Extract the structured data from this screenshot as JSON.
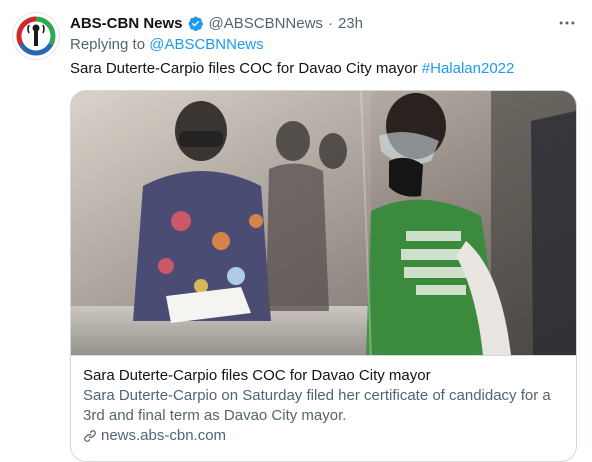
{
  "account": {
    "name": "ABS-CBN News",
    "handle": "@ABSCBNNews",
    "separator": "·",
    "time": "23h",
    "verified": true,
    "avatar_icon": "abs-cbn-logo"
  },
  "reply": {
    "prefix": "Replying to",
    "to": "@ABSCBNNews"
  },
  "tweet": {
    "text": "Sara Duterte-Carpio files COC for Davao City mayor",
    "hashtag": "#Halalan2022"
  },
  "card": {
    "image_description_icon": "photo",
    "title": "Sara Duterte-Carpio files COC for Davao City mayor",
    "description_line1": "Sara Duterte-Carpio on Saturday filed her certificate of candidacy for a",
    "description_line2": "3rd and final term as Davao City mayor.",
    "domain": "news.abs-cbn.com"
  },
  "colors": {
    "link": "#1d9bf0",
    "secondary_text": "#536471",
    "border": "#cfd9de",
    "logo_red": "#d4262c",
    "logo_green": "#2fa84f",
    "logo_blue": "#2767b3"
  }
}
